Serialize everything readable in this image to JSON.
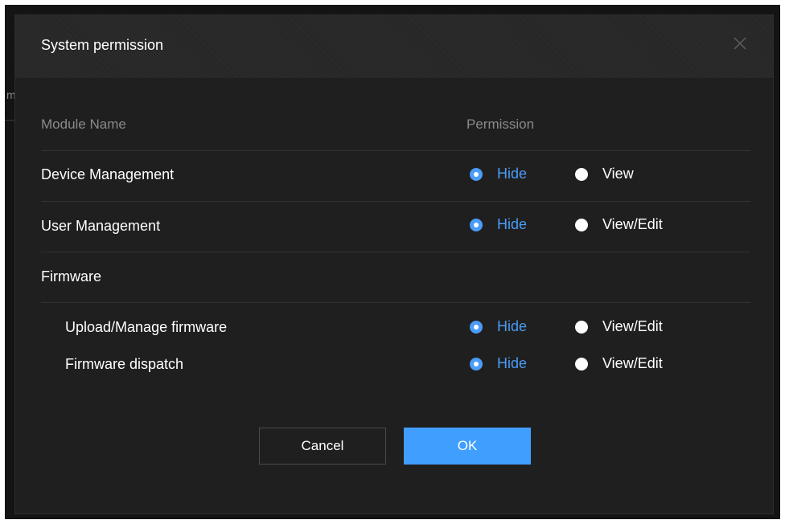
{
  "dialog": {
    "title": "System permission",
    "close_icon": "close-icon",
    "columns": {
      "module": "Module Name",
      "permission": "Permission"
    },
    "rows": [
      {
        "label": "Device Management",
        "options": [
          "Hide",
          "View"
        ],
        "selected": "Hide"
      },
      {
        "label": "User Management",
        "options": [
          "Hide",
          "View/Edit"
        ],
        "selected": "Hide"
      },
      {
        "label": "Firmware"
      },
      {
        "label": "Upload/Manage firmware",
        "options": [
          "Hide",
          "View/Edit"
        ],
        "selected": "Hide"
      },
      {
        "label": "Firmware dispatch",
        "options": [
          "Hide",
          "View/Edit"
        ],
        "selected": "Hide"
      }
    ],
    "buttons": {
      "cancel": "Cancel",
      "ok": "OK"
    }
  },
  "colors": {
    "accent": "#409eff",
    "background": "#1f1f1f",
    "text": "#ffffff",
    "muted": "#8a8a8a"
  }
}
